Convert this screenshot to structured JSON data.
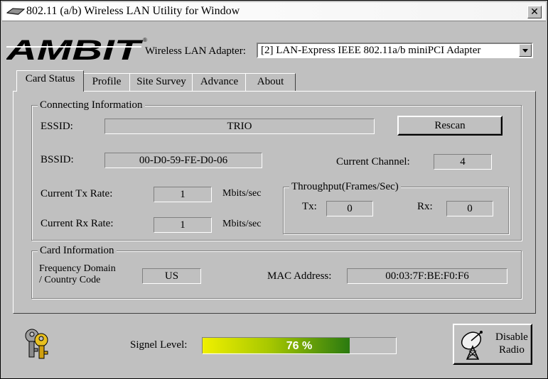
{
  "window": {
    "title": "802.11 (a/b) Wireless LAN Utility for Window",
    "close_label": "✕"
  },
  "brand": {
    "logo_text": "AMBIT",
    "registered_mark": "®"
  },
  "adapter": {
    "label": "Wireless LAN Adapter:",
    "selected": "[2] LAN-Express IEEE 802.11a/b miniPCI Adapter"
  },
  "tabs": [
    {
      "label": "Card Status",
      "active": true
    },
    {
      "label": "Profile"
    },
    {
      "label": "Site Survey"
    },
    {
      "label": "Advance"
    },
    {
      "label": "About"
    }
  ],
  "connecting": {
    "title": "Connecting Information",
    "essid_label": "ESSID:",
    "essid": "TRIO",
    "rescan_label": "Rescan",
    "bssid_label": "BSSID:",
    "bssid": "00-D0-59-FE-D0-06",
    "channel_label": "Current Channel:",
    "channel": "4",
    "tx_rate_label": "Current Tx Rate:",
    "tx_rate": "1",
    "tx_unit": "Mbits/sec",
    "rx_rate_label": "Current Rx Rate:",
    "rx_rate": "1",
    "rx_unit": "Mbits/sec",
    "throughput": {
      "title": "Throughput(Frames/Sec)",
      "tx_label": "Tx:",
      "tx": "0",
      "rx_label": "Rx:",
      "rx": "0"
    }
  },
  "card": {
    "title": "Card Information",
    "freq_label_1": "Frequency Domain",
    "freq_label_2": "/ Country Code",
    "freq": "US",
    "mac_label": "MAC Address:",
    "mac": "00:03:7F:BE:F0:F6"
  },
  "signal": {
    "label": "Signel Level:",
    "value_text": "76 %",
    "level": 0.76
  },
  "radio": {
    "label_1": "Disable",
    "label_2": "Radio"
  },
  "icons": {
    "title": "network-card-icon",
    "keys": "keys-icon",
    "radio": "antenna-dish-icon"
  },
  "colors": {
    "meter_start": "#f0f000",
    "meter_end": "#2a7a10"
  }
}
